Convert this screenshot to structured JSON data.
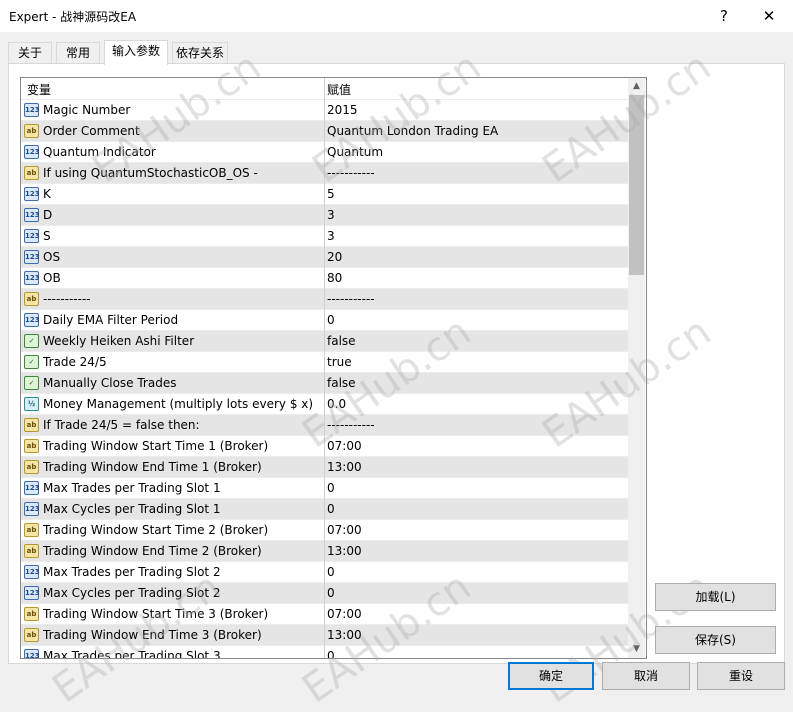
{
  "window": {
    "title": "Expert - 战神源码改EA",
    "help_label": "?",
    "close_label": "✕"
  },
  "tabs": [
    {
      "label": "关于"
    },
    {
      "label": "常用"
    },
    {
      "label": "输入参数"
    },
    {
      "label": "依存关系"
    }
  ],
  "grid": {
    "col_variable": "变量",
    "col_value": "赋值",
    "rows": [
      {
        "icon": "123",
        "name": "Magic Number",
        "value": "2015"
      },
      {
        "icon": "ab",
        "name": "Order Comment",
        "value": "Quantum London Trading EA"
      },
      {
        "icon": "123",
        "name": "Quantum Indicator",
        "value": "Quantum"
      },
      {
        "icon": "ab",
        "name": "If using QuantumStochasticOB_OS -",
        "value": "-----------"
      },
      {
        "icon": "123",
        "name": "K",
        "value": "5"
      },
      {
        "icon": "123",
        "name": "D",
        "value": "3"
      },
      {
        "icon": "123",
        "name": "S",
        "value": "3"
      },
      {
        "icon": "123",
        "name": "OS",
        "value": "20"
      },
      {
        "icon": "123",
        "name": "OB",
        "value": "80"
      },
      {
        "icon": "ab",
        "name": "-----------",
        "value": "-----------"
      },
      {
        "icon": "123",
        "name": "Daily EMA Filter Period",
        "value": "0"
      },
      {
        "icon": "bool",
        "name": "Weekly Heiken Ashi Filter",
        "value": "false"
      },
      {
        "icon": "bool",
        "name": "Trade 24/5",
        "value": "true"
      },
      {
        "icon": "bool",
        "name": "Manually Close Trades",
        "value": "false"
      },
      {
        "icon": "1/2",
        "name": "Money Management (multiply lots every $ x)",
        "value": "0.0"
      },
      {
        "icon": "ab",
        "name": "If Trade 24/5 = false then:",
        "value": "-----------"
      },
      {
        "icon": "ab",
        "name": "Trading Window Start Time 1 (Broker)",
        "value": "07:00"
      },
      {
        "icon": "ab",
        "name": "Trading Window End Time 1 (Broker)",
        "value": "13:00"
      },
      {
        "icon": "123",
        "name": "Max Trades per Trading Slot 1",
        "value": "0"
      },
      {
        "icon": "123",
        "name": "Max Cycles per Trading Slot 1",
        "value": "0"
      },
      {
        "icon": "ab",
        "name": "Trading Window Start Time 2 (Broker)",
        "value": "07:00"
      },
      {
        "icon": "ab",
        "name": "Trading Window End Time 2 (Broker)",
        "value": "13:00"
      },
      {
        "icon": "123",
        "name": "Max Trades per Trading Slot 2",
        "value": "0"
      },
      {
        "icon": "123",
        "name": "Max Cycles per Trading Slot 2",
        "value": "0"
      },
      {
        "icon": "ab",
        "name": "Trading Window Start Time 3 (Broker)",
        "value": "07:00"
      },
      {
        "icon": "ab",
        "name": "Trading Window End Time 3 (Broker)",
        "value": "13:00"
      },
      {
        "icon": "123",
        "name": "Max Trades per Trading Slot 3",
        "value": "0"
      }
    ]
  },
  "buttons": {
    "load": "加载(L)",
    "save": "保存(S)",
    "ok": "确定",
    "cancel": "取消",
    "reset": "重设"
  },
  "watermark": "EAHub.cn"
}
